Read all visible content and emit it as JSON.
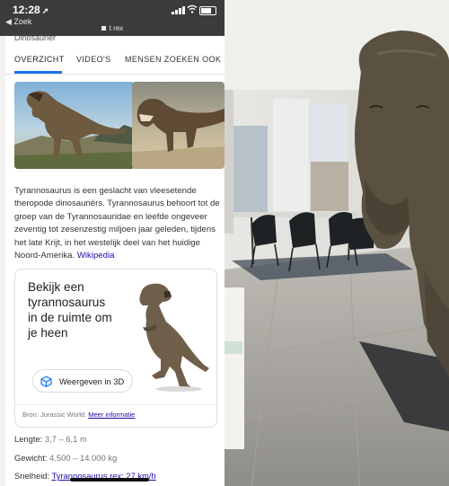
{
  "status": {
    "time": "12:28",
    "back_label": "◀ Zoek",
    "url": "t rex"
  },
  "prev_text": "Dinosaurier",
  "tabs": [
    {
      "label": "OVERZICHT"
    },
    {
      "label": "VIDEO'S"
    },
    {
      "label": "MENSEN ZOEKEN OOK NA"
    }
  ],
  "description": {
    "text": "Tyrannosaurus is een geslacht van vleesetende theropode dinosauriërs. Tyrannosaurus behoort tot de groep van de Tyrannosauridae en leefde ongeveer zeventig tot zesenzestig miljoen jaar geleden, tijdens het late Krijt, in het westelijk deel van het huidige Noord-Amerika.",
    "link": "Wikipedia"
  },
  "ar_card": {
    "title": "Bekijk een tyrannosaurus in de ruimte om je heen",
    "button_label": "Weergeven in 3D",
    "source_text": "Bron: Jurassic World.",
    "more_info": "Meer informatie"
  },
  "facts": [
    {
      "label": "Lengte:",
      "value": "3,7 – 6,1 m"
    },
    {
      "label": "Gewicht:",
      "value": "4.500 – 14.000 kg"
    },
    {
      "label": "Snelheid:",
      "value": "Tyrannosaurus rex: 27 km/h"
    }
  ],
  "colors": {
    "accent": "#1a73e8",
    "link": "#1a0dab",
    "status_bar": "#3b3b3b"
  },
  "icons": [
    "location-arrow-icon",
    "signal-icon",
    "wifi-icon",
    "battery-icon",
    "lock-icon",
    "ar-cube-icon"
  ]
}
